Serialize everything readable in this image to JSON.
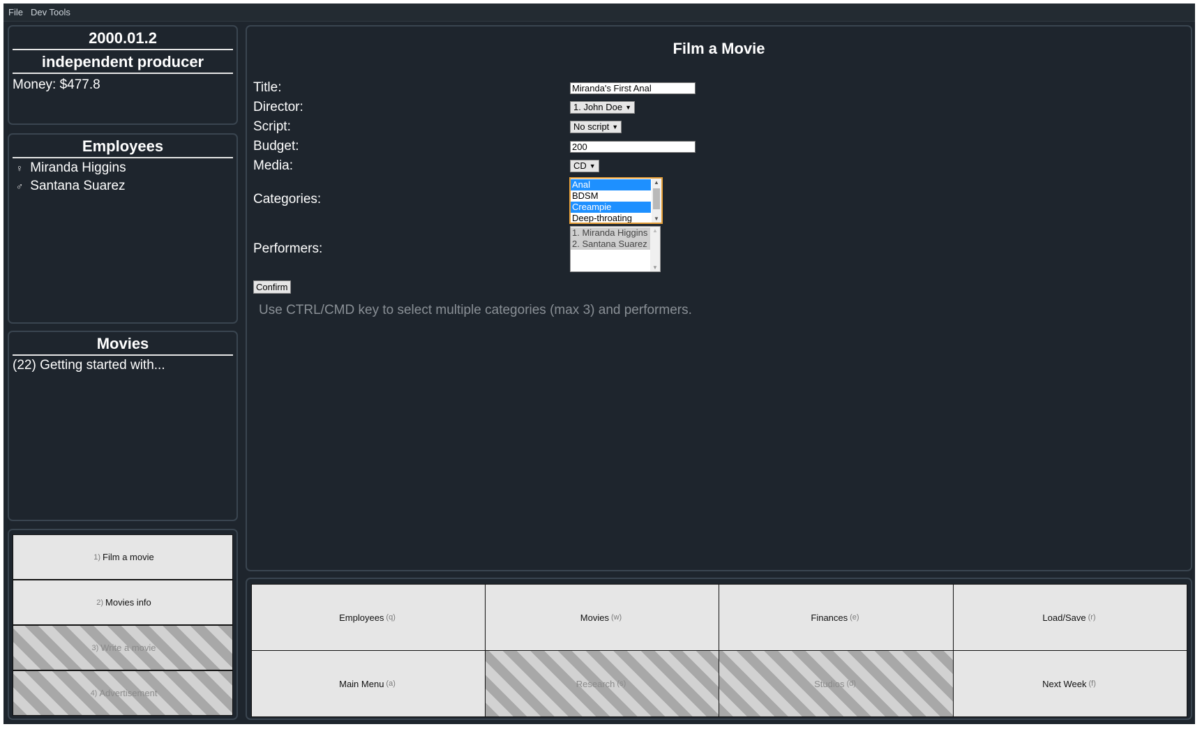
{
  "menubar": {
    "file": "File",
    "dev_tools": "Dev Tools"
  },
  "status": {
    "date": "2000.01.2",
    "rank": "independent producer",
    "money": "Money: $477.8"
  },
  "employees": {
    "title": "Employees",
    "items": [
      {
        "symbol": "♀",
        "name": "Miranda Higgins"
      },
      {
        "symbol": "♂",
        "name": "Santana Suarez"
      }
    ]
  },
  "movies": {
    "title": "Movies",
    "items": [
      "(22) Getting started with..."
    ]
  },
  "actions": [
    {
      "key": "1)",
      "label": "Film a movie",
      "enabled": true
    },
    {
      "key": "2)",
      "label": "Movies info",
      "enabled": true
    },
    {
      "key": "3)",
      "label": "Write a movie",
      "enabled": false
    },
    {
      "key": "4)",
      "label": "Advertisement",
      "enabled": false
    }
  ],
  "form": {
    "title": "Film a Movie",
    "title_label": "Title:",
    "title_value": "Miranda's First Anal",
    "director_label": "Director:",
    "director_value": "1. John Doe",
    "script_label": "Script:",
    "script_value": "No script",
    "budget_label": "Budget:",
    "budget_value": "200",
    "media_label": "Media:",
    "media_value": "CD",
    "categories_label": "Categories:",
    "categories": [
      {
        "name": "Anal",
        "selected": true
      },
      {
        "name": "BDSM",
        "selected": false
      },
      {
        "name": "Creampie",
        "selected": true
      },
      {
        "name": "Deep-throating",
        "selected": false
      }
    ],
    "performers_label": "Performers:",
    "performers": [
      {
        "name": "1. Miranda Higgins",
        "selected": true
      },
      {
        "name": "2. Santana Suarez",
        "selected": true
      }
    ],
    "confirm_label": "Confirm",
    "hint": "Use CTRL/CMD key to select multiple categories (max 3) and performers."
  },
  "nav": [
    {
      "label": "Employees",
      "key": "(q)",
      "enabled": true
    },
    {
      "label": "Movies",
      "key": "(w)",
      "enabled": true
    },
    {
      "label": "Finances",
      "key": "(e)",
      "enabled": true
    },
    {
      "label": "Load/Save",
      "key": "(r)",
      "enabled": true
    },
    {
      "label": "Main Menu",
      "key": "(a)",
      "enabled": true
    },
    {
      "label": "Research",
      "key": "(s)",
      "enabled": false
    },
    {
      "label": "Studios",
      "key": "(d)",
      "enabled": false
    },
    {
      "label": "Next Week",
      "key": "(f)",
      "enabled": true
    }
  ]
}
